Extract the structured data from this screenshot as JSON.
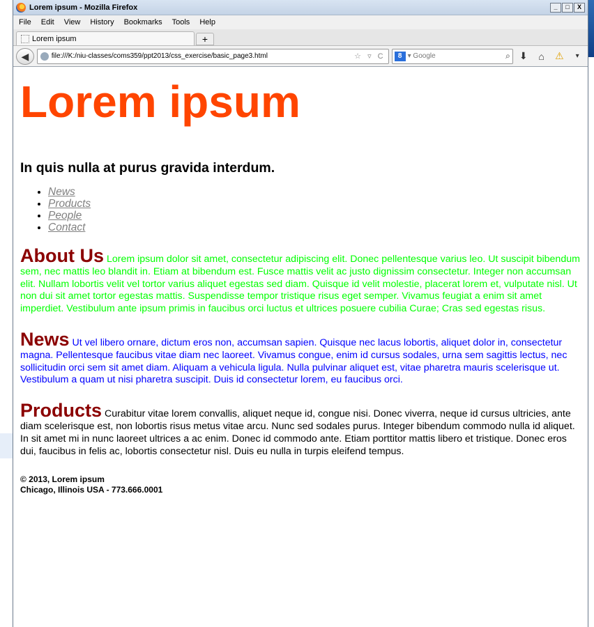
{
  "window": {
    "title": "Lorem ipsum - Mozilla Firefox",
    "controls": [
      "_",
      "□",
      "X"
    ]
  },
  "menu": [
    "File",
    "Edit",
    "View",
    "History",
    "Bookmarks",
    "Tools",
    "Help"
  ],
  "tab": {
    "label": "Lorem ipsum",
    "new_tab": "+"
  },
  "nav": {
    "url": "file:///K:/niu-classes/coms359/ppt2013/css_exercise/basic_page3.html",
    "url_icons": "☆ ▿ C",
    "search_engine": "8",
    "search_placeholder": "▾ Google"
  },
  "page": {
    "title": "Lorem ipsum",
    "subtitle": "In quis nulla at purus gravida interdum.",
    "links": [
      "News",
      "Products",
      "People",
      "Contact"
    ],
    "sections": [
      {
        "heading": "About Us",
        "text": "Lorem ipsum dolor sit amet, consectetur adipiscing elit. Donec pellentesque varius leo. Ut suscipit bibendum sem, nec mattis leo blandit in. Etiam at bibendum est. Fusce mattis velit ac justo dignissim consectetur. Integer non accumsan elit. Nullam lobortis velit vel tortor varius aliquet egestas sed diam. Quisque id velit molestie, placerat lorem et, vulputate nisl. Ut non dui sit amet tortor egestas mattis. Suspendisse tempor tristique risus eget semper. Vivamus feugiat a enim sit amet imperdiet. Vestibulum ante ipsum primis in faucibus orci luctus et ultrices posuere cubilia Curae; Cras sed egestas risus."
      },
      {
        "heading": "News",
        "text": "Ut vel libero ornare, dictum eros non, accumsan sapien. Quisque nec lacus lobortis, aliquet dolor in, consectetur magna. Pellentesque faucibus vitae diam nec laoreet. Vivamus congue, enim id cursus sodales, urna sem sagittis lectus, nec sollicitudin orci sem sit amet diam. Aliquam a vehicula ligula. Nulla pulvinar aliquet est, vitae pharetra mauris scelerisque ut. Vestibulum a quam ut nisi pharetra suscipit. Duis id consectetur lorem, eu faucibus orci."
      },
      {
        "heading": "Products",
        "text": "Curabitur vitae lorem convallis, aliquet neque id, congue nisi. Donec viverra, neque id cursus ultricies, ante diam scelerisque est, non lobortis risus metus vitae arcu. Nunc sed sodales purus. Integer bibendum commodo nulla id aliquet. In sit amet mi in nunc laoreet ultrices a ac enim. Donec id commodo ante. Etiam porttitor mattis libero et tristique. Donec eros dui, faucibus in felis ac, lobortis consectetur nisl. Duis eu nulla in turpis eleifend tempus."
      }
    ],
    "footer": {
      "line1": "© 2013, Lorem ipsum",
      "line2": "Chicago, Illinois USA - 773.666.0001"
    }
  },
  "colors": {
    "title": "#ff4500",
    "section_heading": "#8b0000",
    "about_text": "#00ff00",
    "news_text": "#0000ff",
    "products_text": "#000000",
    "link": "#808080"
  }
}
